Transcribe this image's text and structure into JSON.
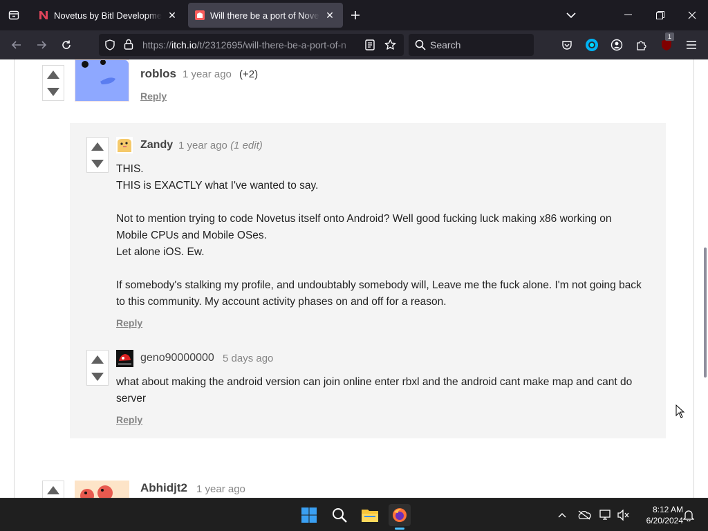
{
  "browser": {
    "tabs": [
      {
        "title": "Novetus by Bitl Development St",
        "active": false
      },
      {
        "title": "Will there be a port of Novetus t",
        "active": true
      }
    ],
    "url": {
      "host": "itch.io",
      "path": "/t/2312695/will-there-be-a-port-of-n"
    },
    "protocol": "https://",
    "search_placeholder": "Search",
    "extension_badge": "1"
  },
  "thread": {
    "top_comment": {
      "username": "roblos",
      "timestamp": "1 year ago",
      "votes": "(+2)",
      "reply": "Reply"
    },
    "replies": [
      {
        "username": "Zandy",
        "timestamp": "1 year ago",
        "edit_note": "(1 edit)",
        "lines": [
          "THIS.",
          "THIS is EXACTLY what I've wanted to say.",
          "",
          "Not to mention trying to code Novetus itself onto Android? Well good fucking luck making x86 working on",
          "Mobile CPUs and Mobile OSes.",
          "Let alone iOS. Ew.",
          "",
          "If somebody's stalking my profile, and undoubtably somebody will, Leave me the fuck alone. I'm not going back",
          "to this community. My account activity phases on and off for a reason."
        ],
        "reply": "Reply"
      },
      {
        "username": "geno90000000",
        "timestamp": "5 days ago",
        "lines": [
          "what about making the android version can join online enter rbxl and the android cant make map and cant do",
          "server"
        ],
        "reply": "Reply"
      }
    ],
    "next_comment": {
      "username": "Abhidjt2",
      "timestamp": "1 year ago"
    }
  },
  "taskbar": {
    "time": "8:12 AM",
    "date": "6/20/2024"
  }
}
